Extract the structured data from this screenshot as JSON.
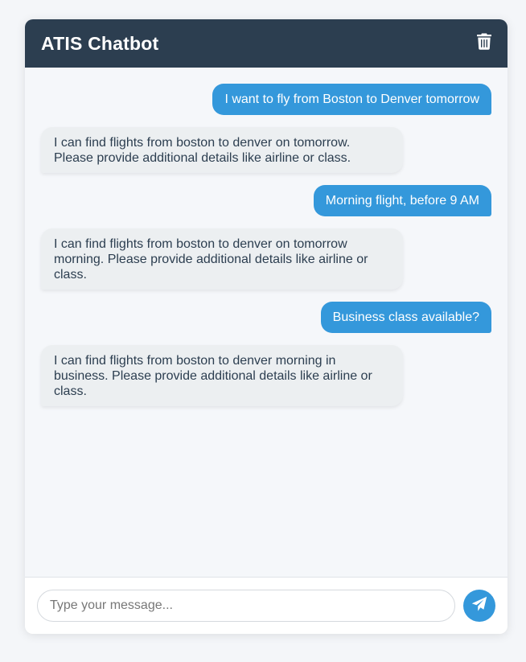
{
  "header": {
    "title": "ATIS Chatbot",
    "clear_icon": "trash-icon"
  },
  "messages": [
    {
      "sender": "user",
      "text": "I want to fly from Boston to Denver tomorrow"
    },
    {
      "sender": "bot",
      "text": "I can find flights from boston to denver on tomorrow. Please provide additional details like airline or class."
    },
    {
      "sender": "user",
      "text": "Morning flight, before 9 AM"
    },
    {
      "sender": "bot",
      "text": "I can find flights from boston to denver on tomorrow morning. Please provide additional details like airline or class."
    },
    {
      "sender": "user",
      "text": "Business class available?"
    },
    {
      "sender": "bot",
      "text": "I can find flights from boston to denver morning in business. Please provide additional details like airline or class."
    }
  ],
  "input": {
    "placeholder": "Type your message...",
    "value": "",
    "send_icon": "paper-plane-icon"
  },
  "colors": {
    "header_bg": "#2c3e50",
    "user_bubble": "#3498db",
    "bot_bubble": "#eceff1",
    "accent": "#3498db"
  }
}
